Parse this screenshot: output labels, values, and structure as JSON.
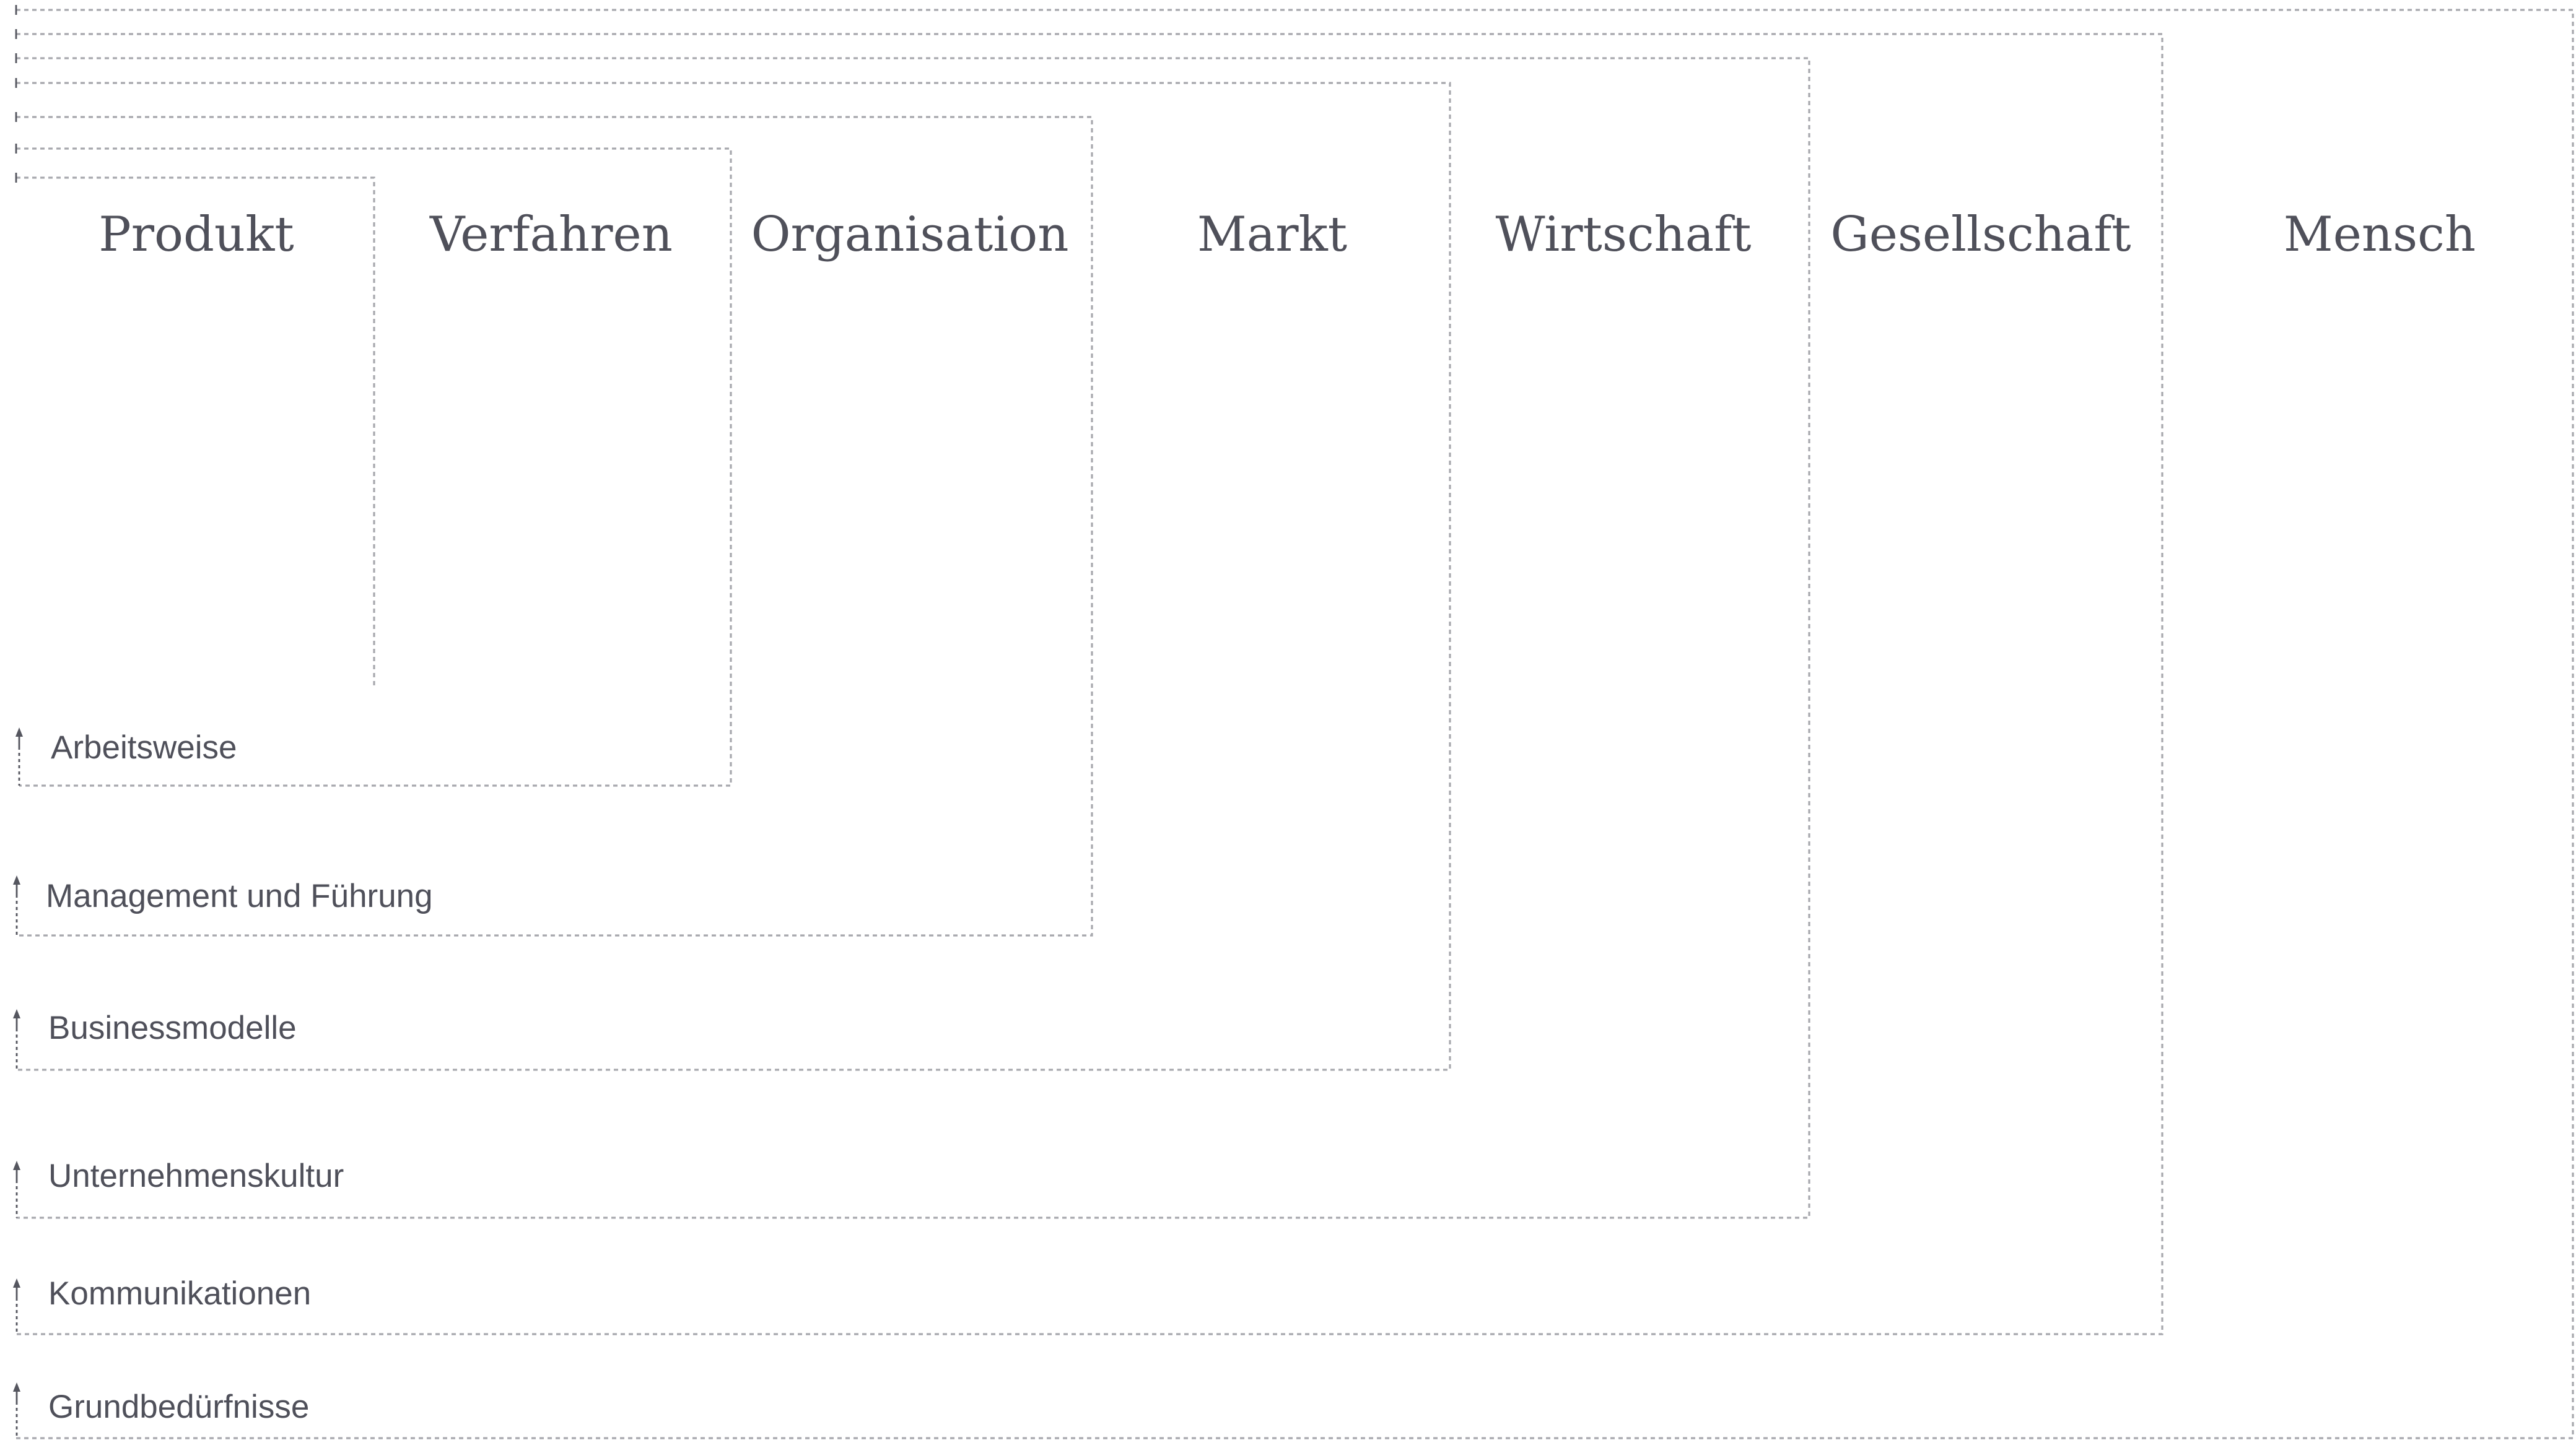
{
  "columns": [
    "Produkt",
    "Verfahren",
    "Organisation",
    "Markt",
    "Wirtschaft",
    "Gesellschaft",
    "Mensch"
  ],
  "rows": [
    "Arbeitsweise",
    "Management und Führung",
    "Businessmodelle",
    "Unternehmenskultur",
    "Kommunikationen",
    "Grundbedürfnisse"
  ]
}
